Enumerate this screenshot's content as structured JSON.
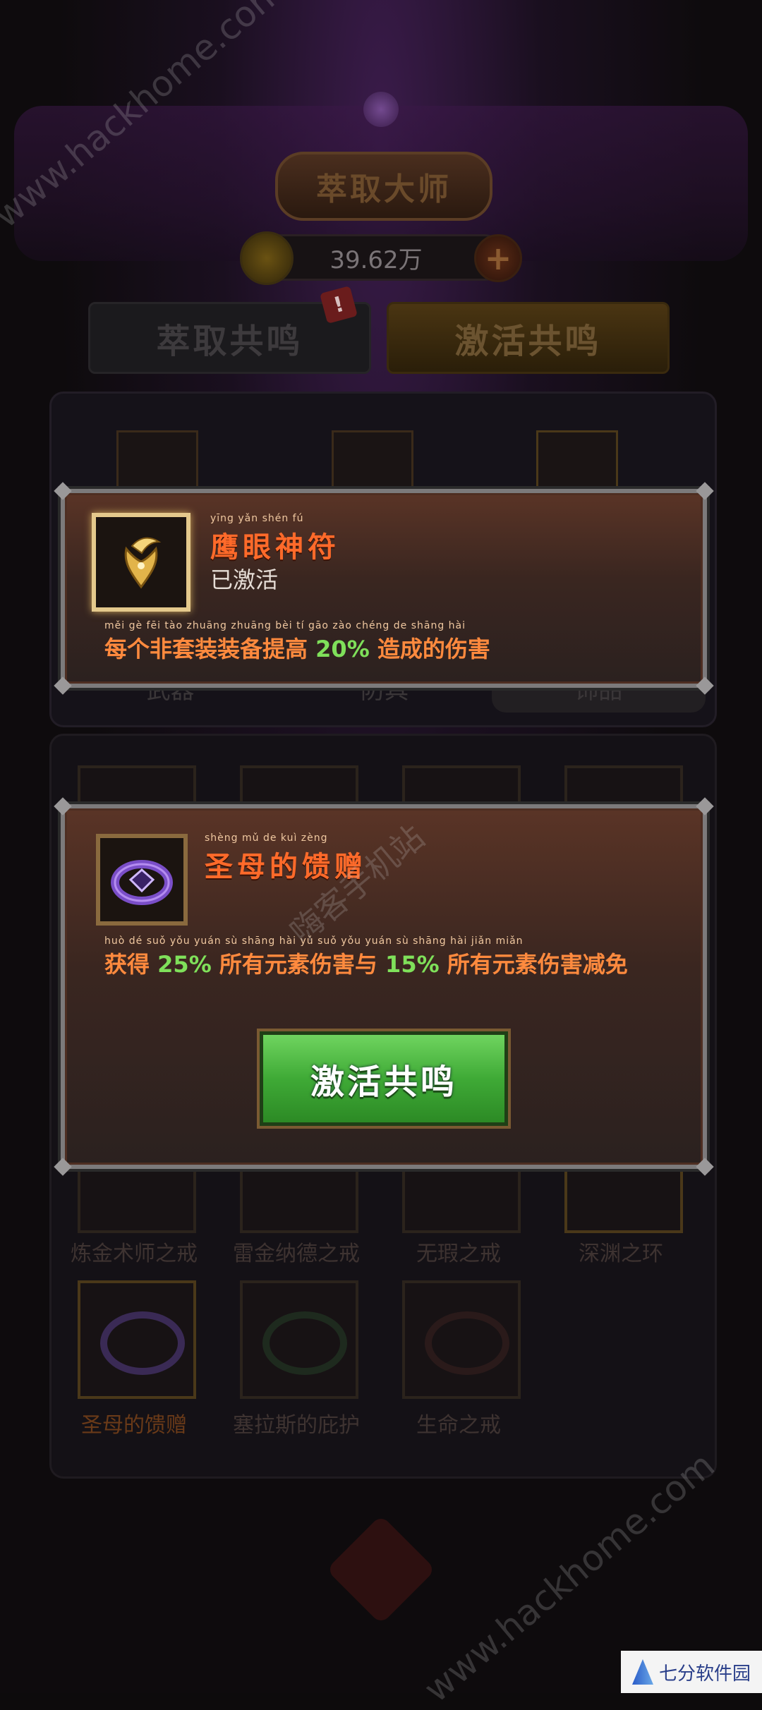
{
  "header": {
    "title": "萃取大师",
    "currency_value": "39.62万",
    "plus_symbol": "+"
  },
  "tabs": [
    {
      "label": "萃取共鸣",
      "active": false
    },
    {
      "label": "激活共鸣",
      "active": true
    }
  ],
  "red_badge": "!",
  "category_tabs": [
    {
      "label": "武器",
      "active": false
    },
    {
      "label": "防具",
      "active": false
    },
    {
      "label": "饰品",
      "active": true
    }
  ],
  "grid_items_row3": [
    "炼金术师之戒",
    "雷金纳德之戒",
    "无瑕之戒",
    "深渊之环"
  ],
  "grid_items_row4": [
    "圣母的馈赠",
    "塞拉斯的庇护",
    "生命之戒"
  ],
  "popup_active": {
    "ruby": "yīng  yǎn  shén  fú",
    "title": "鹰眼神符",
    "status": "已激活",
    "desc_ruby": "měi  gè  fēi  tào  zhuāng zhuāng  bèi  tí  gāo                  zào  chéng  de  shāng  hài",
    "desc_before": "每个非套装装备提高",
    "desc_pct": "20%",
    "desc_after": "造成的伤害"
  },
  "popup_candidate": {
    "ruby": "shèng  mǔ  de  kuì  zèng",
    "title": "圣母的馈赠",
    "desc_ruby": "huò  dé              suǒ  yǒu  yuán  sù  shāng  hài  yǔ                suǒ  yǒu  yuán  sù  shāng  hài  jiǎn  miǎn",
    "desc_a": "获得",
    "pct_a": "25%",
    "desc_b": "所有元素伤害与",
    "pct_b": "15%",
    "desc_c": "所有元素伤害减免",
    "button_label": "激活共鸣"
  },
  "watermarks": {
    "top": "www.hackhome.com",
    "middle": "嗨客手机站",
    "bottom": "www.hackhome.com"
  },
  "corner_logo": "七分软件园",
  "colors": {
    "title_red": "#ff6a2a",
    "percent_green": "#7fe05a",
    "button_green": "#3faa36"
  }
}
